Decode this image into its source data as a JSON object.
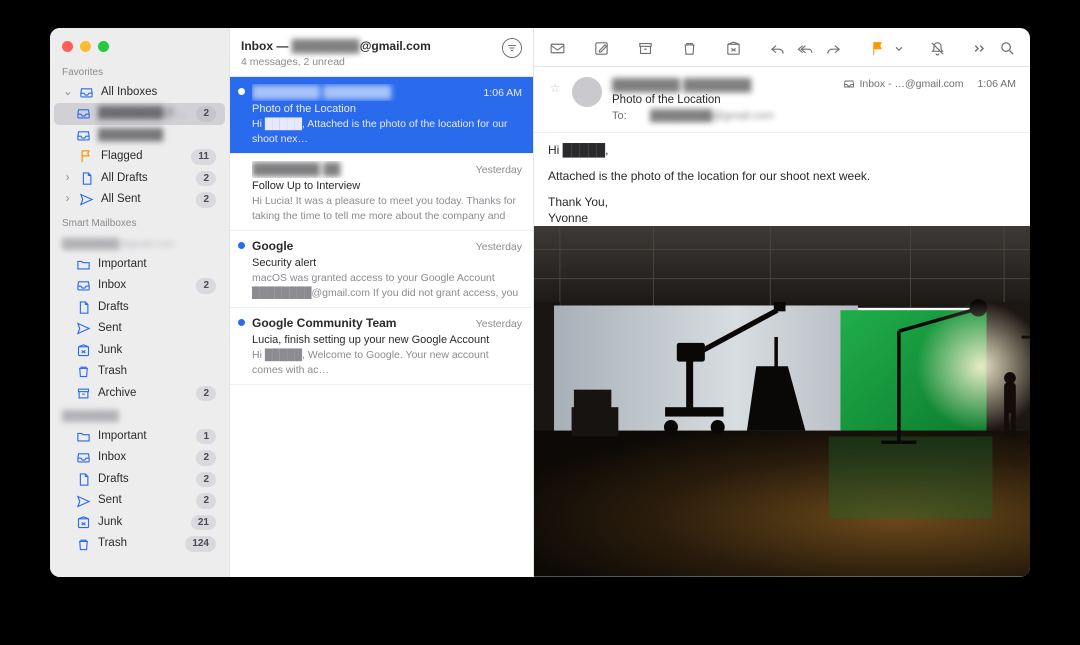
{
  "header": {
    "title_prefix": "Inbox — ",
    "title_account": "@gmail.com",
    "title_account_redacted": "████████",
    "summary": "4 messages, 2 unread"
  },
  "sidebar": {
    "section_favorites": "Favorites",
    "section_smart": "Smart Mailboxes",
    "account_label_redacted": "████████@gmail.com",
    "all_inboxes": "All Inboxes",
    "child_accounts": [
      {
        "label_redacted": "████████@g...",
        "count": 2
      },
      {
        "label_redacted": "████████",
        "count": null
      }
    ],
    "flagged_label": "Flagged",
    "flagged_count": 11,
    "all_drafts_label": "All Drafts",
    "all_drafts_count": 2,
    "all_sent_label": "All Sent",
    "all_sent_count": 2,
    "redacted_group_label": "████████",
    "items_a": [
      {
        "icon": "folder",
        "label": "Important",
        "count": null
      },
      {
        "icon": "inbox",
        "label": "Inbox",
        "count": 2
      },
      {
        "icon": "doc",
        "label": "Drafts",
        "count": null
      },
      {
        "icon": "send",
        "label": "Sent",
        "count": null
      },
      {
        "icon": "junk",
        "label": "Junk",
        "count": null
      },
      {
        "icon": "trash",
        "label": "Trash",
        "count": null
      },
      {
        "icon": "archive",
        "label": "Archive",
        "count": 2
      }
    ],
    "items_b": [
      {
        "icon": "folder",
        "label": "Important",
        "count": 1
      },
      {
        "icon": "inbox",
        "label": "Inbox",
        "count": 2
      },
      {
        "icon": "doc",
        "label": "Drafts",
        "count": 2
      },
      {
        "icon": "send",
        "label": "Sent",
        "count": 2
      },
      {
        "icon": "junk",
        "label": "Junk",
        "count": 21
      },
      {
        "icon": "trash",
        "label": "Trash",
        "count": 124
      }
    ]
  },
  "messages": [
    {
      "unread": true,
      "from_redacted": "████████ ████████",
      "subject": "Photo of the Location",
      "snippet": "Hi █████, Attached is the photo of the location for our shoot nex…",
      "time": "1:06 AM",
      "selected": true
    },
    {
      "unread": false,
      "from_redacted": "████████ ██",
      "subject": "Follow Up to Interview",
      "snippet": "Hi Lucia! It was a pleasure to meet you today. Thanks for taking the time to tell me more about the company and the position. I…",
      "time": "Yesterday",
      "selected": false
    },
    {
      "unread": true,
      "from": "Google",
      "subject": "Security alert",
      "snippet": "macOS was granted access to your Google Account ████████@gmail.com If you did not grant access, you should c…",
      "time": "Yesterday",
      "selected": false
    },
    {
      "unread": true,
      "from": "Google Community Team",
      "subject": "Lucia, finish setting up your new Google Account",
      "snippet": "Hi █████, Welcome to Google. Your new account comes with ac…",
      "time": "Yesterday",
      "selected": false
    }
  ],
  "reader": {
    "from_redacted": "████████ ████████",
    "subject": "Photo of the Location",
    "to_label": "To:",
    "to_value_redacted": "████████@gmail.com",
    "folder_label": "Inbox - …@gmail.com",
    "time": "1:06 AM",
    "body_lines": [
      "Hi █████,",
      "Attached is the photo of the location for our shoot next week.",
      "Thank You,",
      "Yvonne"
    ]
  },
  "flag_color": "#ff9500"
}
